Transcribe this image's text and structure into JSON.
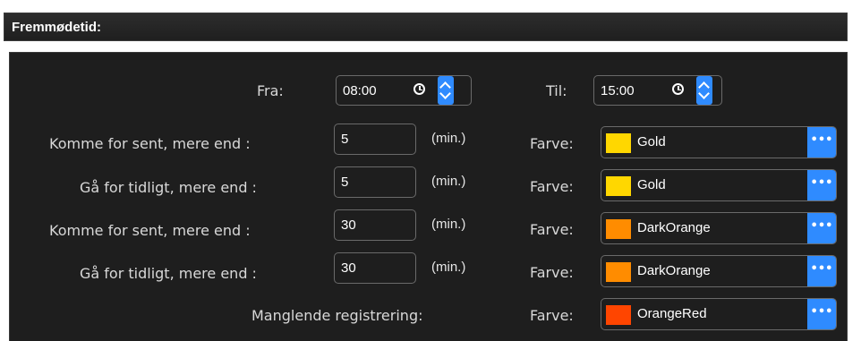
{
  "header": {
    "title": "Fremmødetid:"
  },
  "time": {
    "from_label": "Fra:",
    "from_value": "08:00",
    "to_label": "Til:",
    "to_value": "15:00"
  },
  "rows": [
    {
      "label": "Komme for sent, mere end :",
      "value": "5",
      "unit": "(min.)",
      "color_label": "Farve:",
      "color_name": "Gold",
      "color": "#FFD700"
    },
    {
      "label": "Gå for tidligt, mere end :",
      "value": "5",
      "unit": "(min.)",
      "color_label": "Farve:",
      "color_name": "Gold",
      "color": "#FFD700"
    },
    {
      "label": "Komme for sent, mere end :",
      "value": "30",
      "unit": "(min.)",
      "color_label": "Farve:",
      "color_name": "DarkOrange",
      "color": "#FF8C00"
    },
    {
      "label": "Gå for tidligt, mere end :",
      "value": "30",
      "unit": "(min.)",
      "color_label": "Farve:",
      "color_name": "DarkOrange",
      "color": "#FF8C00"
    }
  ],
  "missing": {
    "label": "Manglende registrering:",
    "color_label": "Farve:",
    "color_name": "OrangeRed",
    "color": "#FF4500"
  },
  "picker_button": "•••"
}
